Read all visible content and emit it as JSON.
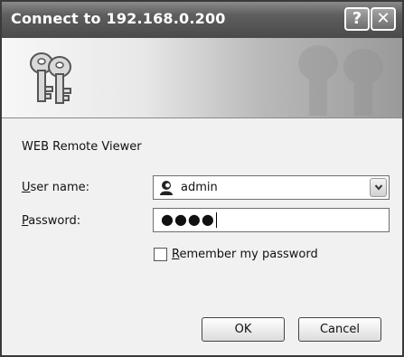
{
  "window": {
    "title": "Connect to 192.168.0.200"
  },
  "titlebar": {
    "help_glyph": "?",
    "close_glyph": "✕"
  },
  "banner": {
    "icon": "keys-icon"
  },
  "form": {
    "realm_text": "WEB Remote Viewer",
    "username_label_underlined": "U",
    "username_label_rest": "ser name:",
    "username_value": "admin",
    "username_icon": "user-icon",
    "password_label_underlined": "P",
    "password_label_rest": "assword:",
    "password_masked": "●●●●",
    "remember_label_underlined": "R",
    "remember_label_rest": "emember my password"
  },
  "buttons": {
    "ok": "OK",
    "cancel": "Cancel"
  }
}
